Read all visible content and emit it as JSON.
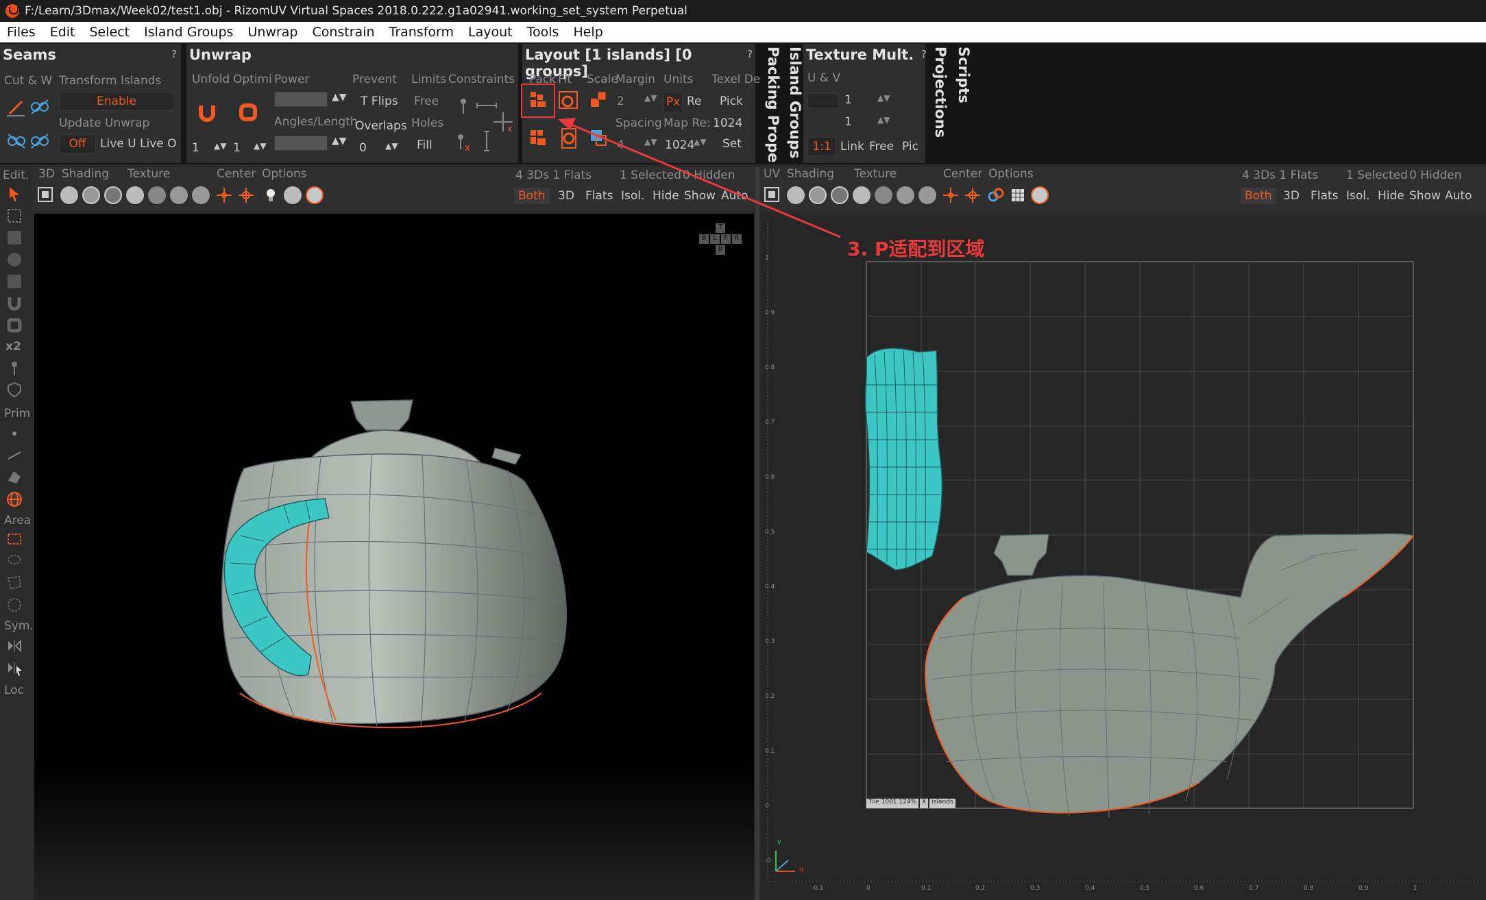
{
  "window": {
    "title": "F:/Learn/3Dmax/Week02/test1.obj - RizomUV  Virtual Spaces 2018.0.222.g1a02941.working_set_system Perpetual"
  },
  "menu": [
    "Files",
    "Edit",
    "Select",
    "Island Groups",
    "Unwrap",
    "Constrain",
    "Transform",
    "Layout",
    "Tools",
    "Help"
  ],
  "seams_panel": {
    "title": "Seams",
    "help": "?",
    "cut_label": "Cut & W",
    "transform_islands": "Transform Islands",
    "enable": "Enable",
    "update_unwrap": "Update Unwrap",
    "off": "Off",
    "live_u": "Live U",
    "live_o": "Live O"
  },
  "unwrap_panel": {
    "title": "Unwrap",
    "unfold": "Unfold",
    "optimi": "Optimi",
    "power": "Power",
    "angles": "Angles/Length",
    "prevent": "Prevent",
    "t_flips": "T Flips",
    "overlaps": "Overlaps",
    "limits": "Limits",
    "constraints": "Constraints",
    "free": "Free",
    "holes": "Holes",
    "fill": "Fill",
    "stepper_a": "1",
    "stepper_b": "1",
    "stepper_c": "0"
  },
  "layout_panel": {
    "title": "Layout [1 islands] [0 groups]",
    "help": "?",
    "pack": "Pack",
    "fit": "Fit",
    "scale": "Scale",
    "margin": "Margin",
    "margin_val": "2",
    "spacing": "Spacing",
    "spacing_val": "4",
    "units": "Units",
    "px": "Px",
    "re": "Re",
    "map_res": "Map Re:",
    "texel": "Texel De",
    "pick": "Pick",
    "res1": "1024",
    "res2": "1024",
    "set": "Set"
  },
  "vertical_tabs": [
    "Packing Properti",
    "Island Groups"
  ],
  "texture_panel": {
    "title": "Texture Mult.",
    "help": "?",
    "uv": "U & V",
    "val1": "1",
    "val2": "1",
    "one_to_one": "1:1",
    "link": "Link",
    "free": "Free",
    "pic": "Pic"
  },
  "vertical_tabs_right": [
    "Projections",
    "Scripts"
  ],
  "leftbar": {
    "edit": "Edit.",
    "prim": "Prim",
    "area": "Area",
    "sym": "Sym.",
    "loc": "Loc",
    "x2": "x2"
  },
  "view3d": {
    "menu": [
      "3D",
      "Shading",
      "Texture",
      "Center",
      "Options"
    ],
    "stats": "4 3Ds 1 Flats",
    "selected": "1 Selected",
    "hidden": "0 Hidden",
    "modes": [
      "Both",
      "3D",
      "Flats",
      "Isol.",
      "Hide",
      "Show",
      "Auto"
    ],
    "cube": [
      "T",
      "B",
      "L",
      "F",
      "R",
      "B"
    ]
  },
  "viewuv": {
    "menu": [
      "UV",
      "Shading",
      "Texture",
      "Center",
      "Options"
    ],
    "stats": "4 3Ds 1 Flats",
    "selected": "1 Selected",
    "hidden": "0 Hidden",
    "modes": [
      "Both",
      "3D",
      "Flats",
      "Isol.",
      "Hide",
      "Show",
      "Auto"
    ],
    "tile_label": "Tile 1001 124%",
    "tile_x": "X",
    "tile_islands": "islands",
    "y_ticks": [
      "1",
      "0.9",
      "0.8",
      "0.7",
      "0.6",
      "0.5",
      "0.4",
      "0.3",
      "0.2",
      "0.1",
      "0",
      "-0."
    ],
    "x_ticks": [
      "-0.1",
      "0",
      "0.1",
      "0.2",
      "0.3",
      "0.4",
      "0.5",
      "0.6",
      "0.7",
      "0.8",
      "0.9",
      "1"
    ],
    "axis_v": "v",
    "axis_u": "u"
  },
  "annotation": {
    "text": "3. P适配到区域"
  },
  "colors": {
    "accent": "#f05a1e",
    "teal": "#3cc6c4",
    "mesh": "#8a958c",
    "annotation": "#e83a3a"
  }
}
